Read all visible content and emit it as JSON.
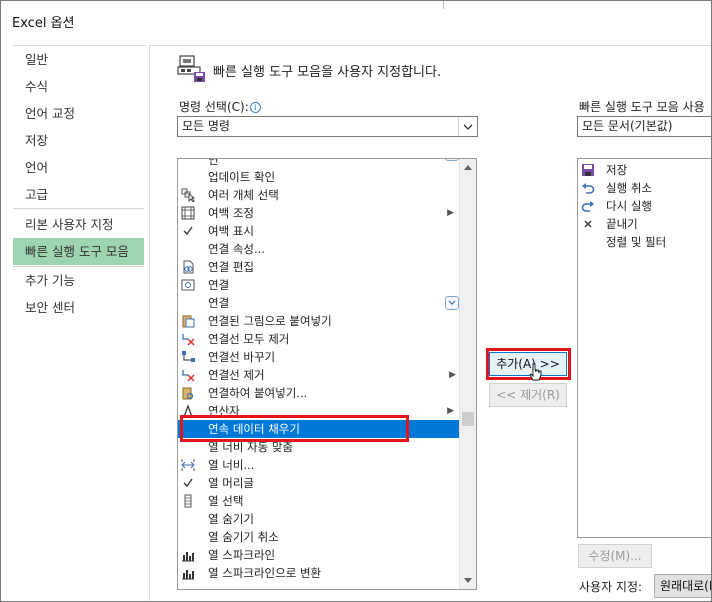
{
  "window": {
    "title": "Excel 옵션"
  },
  "sidebar": {
    "items": [
      {
        "label": "일반"
      },
      {
        "label": "수식"
      },
      {
        "label": "언어 교정"
      },
      {
        "label": "저장"
      },
      {
        "label": "언어"
      },
      {
        "label": "고급"
      },
      {
        "label": "리본 사용자 지정"
      },
      {
        "label": "빠른 실행 도구 모음",
        "active": true
      },
      {
        "label": "추가 기능"
      },
      {
        "label": "보안 센터"
      }
    ]
  },
  "header": {
    "text": "빠른 실행 도구 모음을 사용자 지정합니다."
  },
  "commands": {
    "label": "명령 선택(C):",
    "info": "i",
    "selected": "모든 명령",
    "items": [
      {
        "label": "업데이트 확인",
        "icon": "none"
      },
      {
        "label": "여러 개체 선택",
        "icon": "select-objects-icon"
      },
      {
        "label": "여백 조정",
        "icon": "margins-icon",
        "submenu": true
      },
      {
        "label": "여백 표시",
        "icon": "check-icon"
      },
      {
        "label": "연결 속성...",
        "icon": "none"
      },
      {
        "label": "연결 편집",
        "icon": "edit-links-icon"
      },
      {
        "label": "연결",
        "icon": "connection-icon"
      },
      {
        "label": "연결",
        "icon": "none",
        "dropdown": true
      },
      {
        "label": "연결된 그림으로 붙여넣기",
        "icon": "paste-picture-icon"
      },
      {
        "label": "연결선 모두 제거",
        "icon": "remove-connectors-icon"
      },
      {
        "label": "연결선 바꾸기",
        "icon": "swap-connector-icon"
      },
      {
        "label": "연결선 제거",
        "icon": "remove-connector-icon",
        "submenu": true
      },
      {
        "label": "연결하여 붙여넣기...",
        "icon": "paste-link-icon"
      },
      {
        "label": "연산자",
        "icon": "operator-icon",
        "submenu": true
      },
      {
        "label": "연속 데이터 채우기",
        "icon": "none",
        "selected": true
      },
      {
        "label": "열 너비 자동 맞춤",
        "icon": "none"
      },
      {
        "label": "열 너비...",
        "icon": "column-width-icon"
      },
      {
        "label": "열 머리글",
        "icon": "check-icon"
      },
      {
        "label": "열 선택",
        "icon": "select-column-icon"
      },
      {
        "label": "열 숨기기",
        "icon": "none"
      },
      {
        "label": "열 숨기기 취소",
        "icon": "none"
      },
      {
        "label": "열 스파크라인",
        "icon": "sparkline-icon"
      },
      {
        "label": "열 스파크라인으로 변환",
        "icon": "sparkline-icon"
      }
    ]
  },
  "qat": {
    "label": "빠른 실행 도구 모음 사용",
    "selected": "모든 문서(기본값)",
    "items": [
      {
        "label": "저장",
        "icon": "save-icon"
      },
      {
        "label": "실행 취소",
        "icon": "undo-icon"
      },
      {
        "label": "다시 실행",
        "icon": "redo-icon"
      },
      {
        "label": "끝내기",
        "icon": "close-icon"
      },
      {
        "label": "정렬 및 필터",
        "icon": "none"
      }
    ]
  },
  "buttons": {
    "add": "추가(A) >>",
    "remove": "<< 제거(R)",
    "modify": "수정(M)...",
    "reset": "원래대로(E"
  },
  "customize": {
    "label": "사용자 지정:"
  },
  "colors": {
    "accent": "#0078d7",
    "active_nav": "#9fd4b1",
    "highlight": "#e4141b"
  }
}
